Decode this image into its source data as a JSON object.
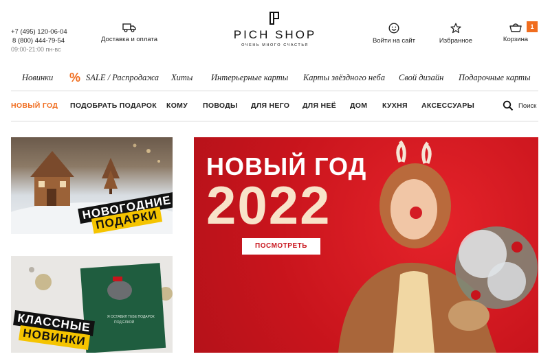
{
  "header": {
    "phone1": "+7 (495) 120-06-04",
    "phone2": "8 (800) 444-79-54",
    "hours": "09:00-21:00 пн-вс",
    "delivery": "Доставка и оплата",
    "login": "Войти на сайт",
    "favorites": "Избранное",
    "cart": "Корзина",
    "cart_count": "1"
  },
  "logo": {
    "name": "PICH SHOP",
    "tagline": "ОЧЕНЬ МНОГО СЧАСТЬЯ"
  },
  "categories": [
    "Новинки",
    "SALE / Распродажа",
    "Хиты",
    "Интерьерные карты",
    "Карты звёздного неба",
    "Свой дизайн",
    "Подарочные карты"
  ],
  "percent_icon": "%",
  "nav": [
    "НОВЫЙ ГОД",
    "ПОДОБРАТЬ ПОДАРОК",
    "КОМУ",
    "ПОВОДЫ",
    "ДЛЯ НЕГО",
    "ДЛЯ НЕЁ",
    "ДОМ",
    "КУХНЯ",
    "АКСЕССУАРЫ"
  ],
  "search_label": "Поиск",
  "banners": {
    "gifts": {
      "line1": "НОВОГОДНИЕ",
      "line2": "ПОДАРКИ"
    },
    "new": {
      "line1": "КЛАССНЫЕ",
      "line2": "НОВИНКИ"
    },
    "hero": {
      "title": "НОВЫЙ ГОД",
      "year": "2022",
      "button": "ПОСМОТРЕТЬ"
    }
  },
  "colors": {
    "accent": "#f06d1f",
    "hero_red": "#c8141c",
    "tag_yellow": "#f5c400"
  }
}
